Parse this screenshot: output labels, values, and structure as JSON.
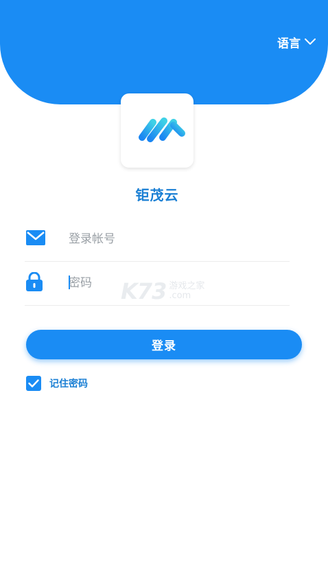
{
  "header": {
    "language_label": "语言",
    "brand_color": "#1a8cf4"
  },
  "app": {
    "name": "钜茂云"
  },
  "form": {
    "account": {
      "placeholder": "登录帐号",
      "value": ""
    },
    "password": {
      "placeholder": "密码",
      "value": ""
    },
    "login_label": "登录",
    "remember_label": "记住密码",
    "remember_checked": true
  },
  "watermark": {
    "logo": "K73",
    "text": "游戏之家",
    "domain": ".com"
  },
  "icons": [
    "chevron-down-icon",
    "app-logo",
    "mail-icon",
    "lock-icon",
    "check-icon"
  ]
}
